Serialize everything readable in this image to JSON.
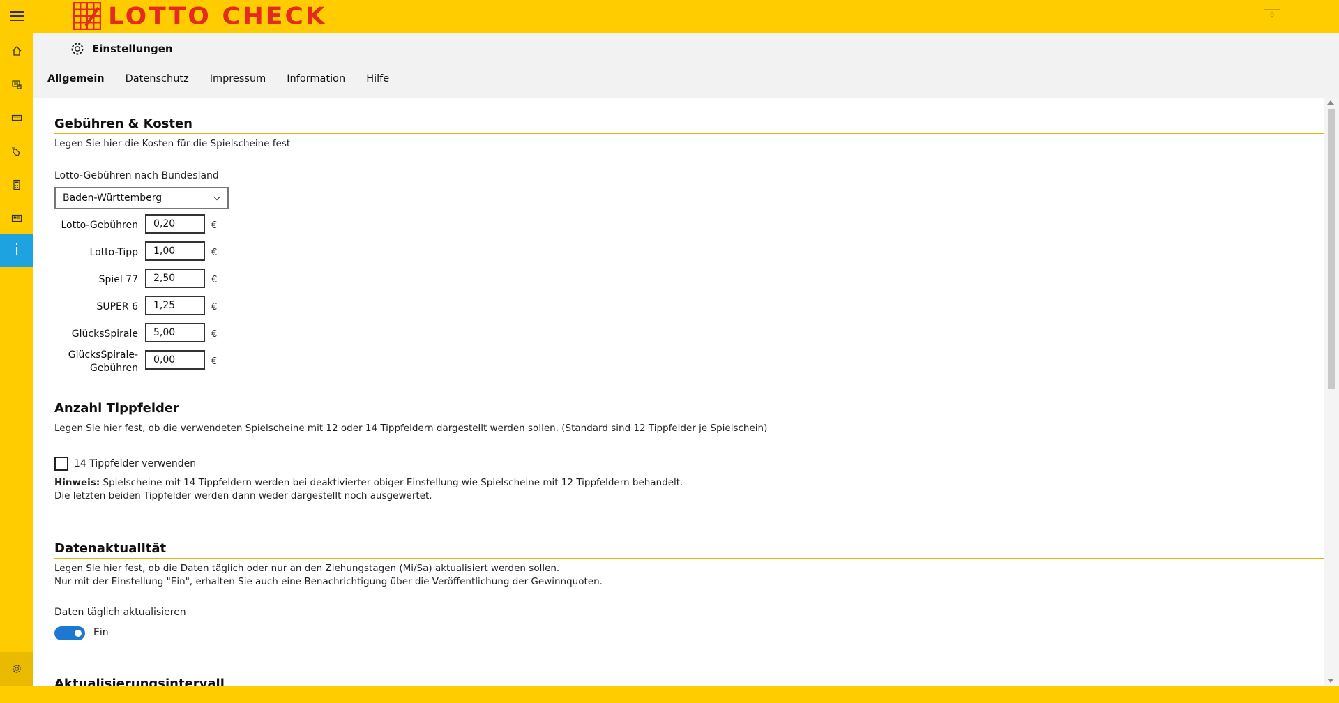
{
  "app": {
    "title": "LOTTO CHECK",
    "notification_count": "0"
  },
  "header": {
    "title": "Einstellungen",
    "tabs": [
      "Allgemein",
      "Datenschutz",
      "Impressum",
      "Information",
      "Hilfe"
    ]
  },
  "fees": {
    "title": "Gebühren & Kosten",
    "description": "Legen Sie hier die Kosten für die Spielscheine fest",
    "state_label": "Lotto-Gebühren nach Bundesland",
    "state_selected": "Baden-Württemberg",
    "currency": "€",
    "rows": [
      {
        "label": "Lotto-Gebühren",
        "value": "0,20"
      },
      {
        "label": "Lotto-Tipp",
        "value": "1,00"
      },
      {
        "label": "Spiel 77",
        "value": "2,50"
      },
      {
        "label": "SUPER 6",
        "value": "1,25"
      },
      {
        "label": "GlücksSpirale",
        "value": "5,00"
      },
      {
        "label_line1": "GlücksSpirale-",
        "label_line2": "Gebühren",
        "value": "0,00"
      }
    ]
  },
  "tippfelder": {
    "title": "Anzahl Tippfelder",
    "description": "Legen Sie hier fest, ob die verwendeten Spielscheine mit 12 oder 14 Tippfeldern dargestellt werden sollen. (Standard sind 12 Tippfelder je Spielschein)",
    "checkbox_label": "14 Tippfelder verwenden",
    "checked": false,
    "hint_bold": "Hinweis:",
    "hint_line1": "Spielscheine mit 14 Tippfeldern werden bei deaktivierter obiger Einstellung wie Spielscheine mit 12 Tippfeldern behandelt.",
    "hint_line2": "Die letzten beiden Tippfelder werden dann weder dargestellt noch ausgewertet."
  },
  "datenaktualitaet": {
    "title": "Datenaktualität",
    "line1": "Legen Sie hier fest, ob die Daten täglich oder nur an den Ziehungstagen (Mi/Sa) aktualisiert werden sollen.",
    "line2": "Nur mit der Einstellung \"Ein\", erhalten Sie auch eine Benachrichtigung über die Veröffentlichung der Gewinnquoten.",
    "toggle_label": "Daten täglich aktualisieren",
    "toggle_state": "Ein"
  },
  "next_section": {
    "title": "Aktualisierungsintervall"
  },
  "colors": {
    "brand_yellow": "#ffcc00",
    "logo_red": "#e52a1f",
    "active_blue": "#1fa3e0",
    "toggle_blue": "#1e78d2"
  }
}
